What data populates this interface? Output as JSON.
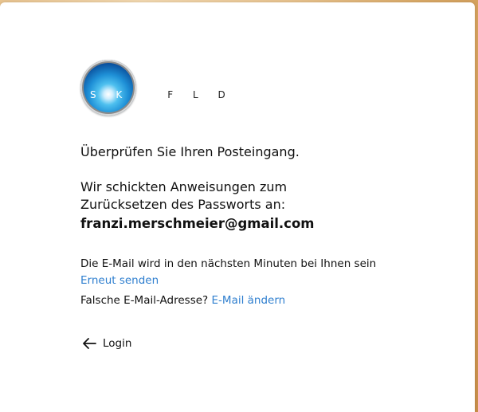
{
  "brand": {
    "logo_on_circle": "S K Y",
    "logo_off_circle": "F L D"
  },
  "heading": "Überprüfen Sie Ihren Posteingang.",
  "instructions": "Wir schickten Anweisungen zum Zurücksetzen des Passworts an:",
  "email": "franzi.merschmeier@gmail.com",
  "note": {
    "text": "Die E-Mail wird in den nächsten Minuten bei Ihnen sein",
    "resend_link": "Erneut senden"
  },
  "wrong_address": {
    "text": "Falsche E-Mail-Adresse?",
    "change_link": "E-Mail ändern"
  },
  "back": {
    "label": "Login",
    "icon": "arrow-left-icon"
  },
  "colors": {
    "link": "#2f7fcf",
    "text": "#111111",
    "card": "#ffffff"
  }
}
